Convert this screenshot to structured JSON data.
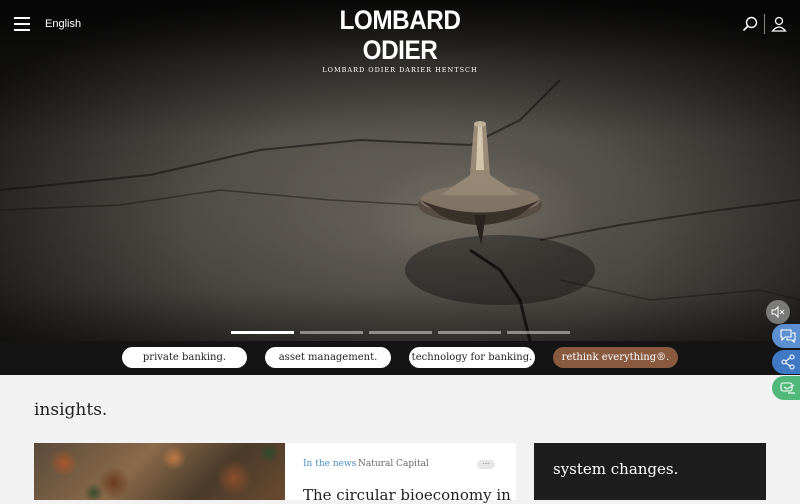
{
  "header": {
    "language": "English",
    "logo_main": "LOMBARD ODIER",
    "logo_sub": "LOMBARD ODIER DARIER HENTSCH"
  },
  "hero": {
    "slides_total": 5,
    "active_slide": 1
  },
  "tabs": [
    {
      "label": "private banking."
    },
    {
      "label": "asset management."
    },
    {
      "label": "technology for banking."
    },
    {
      "label": "rethink everything®."
    }
  ],
  "side_actions": [
    "chat-icon",
    "share-icon",
    "contact-icon"
  ],
  "insights": {
    "title": "insights.",
    "card": {
      "category": "In the news",
      "separator": "·",
      "topic": "Natural Capital",
      "more": "···",
      "title": "The circular bioeconomy in"
    },
    "dark_card_title": "system changes."
  },
  "colors": {
    "accent": "#8a5a40",
    "side_chat": "#5b8fd0",
    "side_share": "#3f79c4",
    "side_contact": "#4fb87a",
    "link": "#4a90c9"
  }
}
